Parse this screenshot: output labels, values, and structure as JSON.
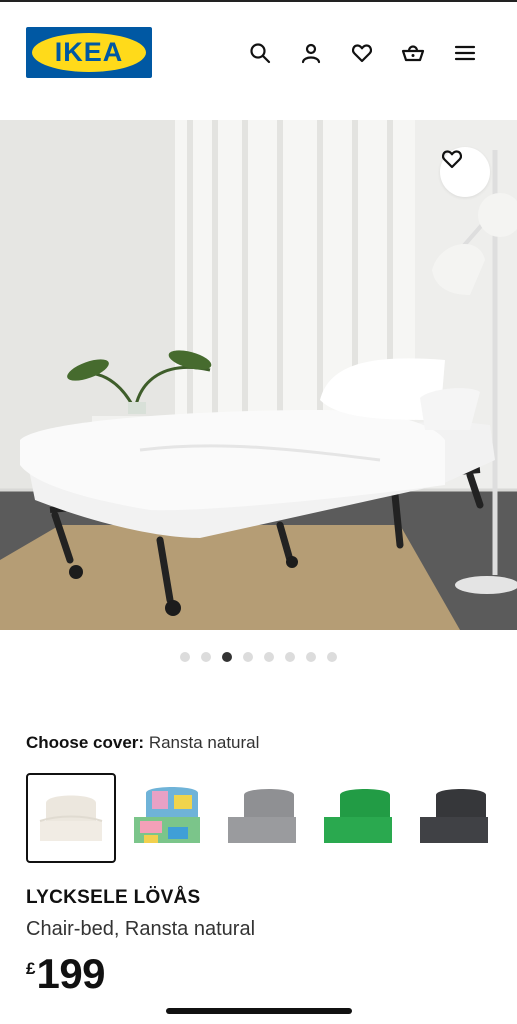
{
  "header": {
    "logo_text": "IKEA",
    "brand_colors": {
      "blue": "#0058a3",
      "yellow": "#ffda1a"
    },
    "icons": [
      "search-icon",
      "user-icon",
      "heart-icon",
      "basket-icon",
      "menu-icon"
    ]
  },
  "hero": {
    "favourite_icon": "heart-icon",
    "carousel": {
      "total": 8,
      "active_index": 2
    }
  },
  "cover": {
    "label": "Choose cover:",
    "value": "Ransta natural",
    "options": [
      {
        "name": "ransta-natural",
        "color": "#ebe6dd",
        "selected": true
      },
      {
        "name": "multicolour",
        "color": "#7fb8d6",
        "selected": false
      },
      {
        "name": "grey",
        "color": "#9b9c9e",
        "selected": false
      },
      {
        "name": "green",
        "color": "#2aa04a",
        "selected": false
      },
      {
        "name": "dark-grey",
        "color": "#3b3c3e",
        "selected": false
      }
    ]
  },
  "product": {
    "name": "LYCKSELE LÖVÅS",
    "description": "Chair-bed, Ransta natural",
    "currency": "£",
    "price": "199"
  }
}
